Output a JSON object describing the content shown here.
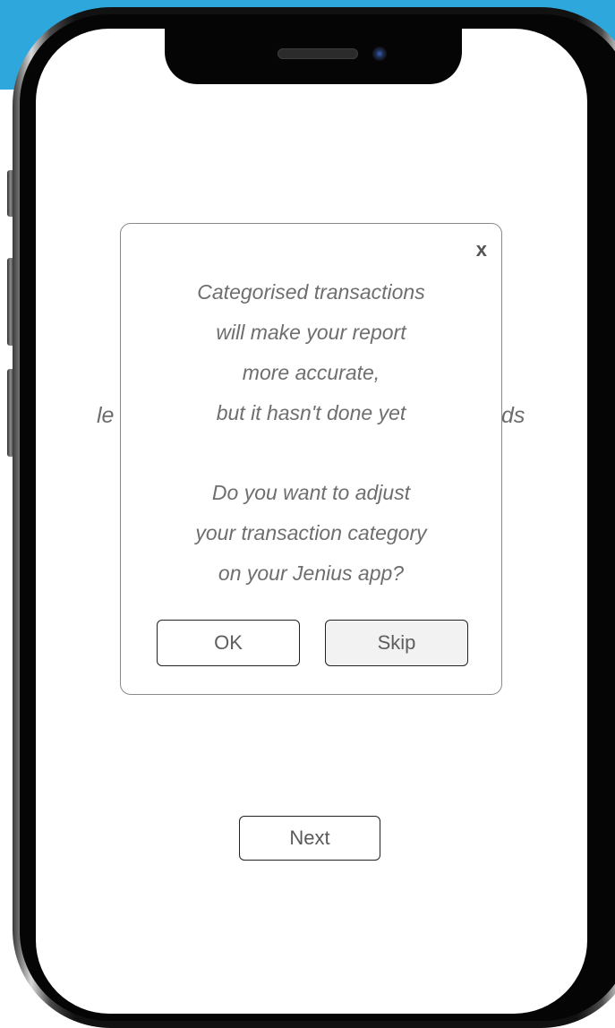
{
  "dialog": {
    "close_label": "x",
    "message_lines_1": [
      "Categorised transactions",
      "will make your report",
      "more accurate,",
      "but it hasn't done yet"
    ],
    "message_lines_2": [
      "Do you want to adjust",
      "your transaction category",
      "on your Jenius app?"
    ],
    "ok_label": "OK",
    "skip_label": "Skip"
  },
  "background": {
    "partial_left": "le",
    "partial_right": "ds",
    "next_label": "Next"
  },
  "colors": {
    "accent_blue": "#2ea7dd",
    "skip_button_bg": "#f2f2f2"
  }
}
